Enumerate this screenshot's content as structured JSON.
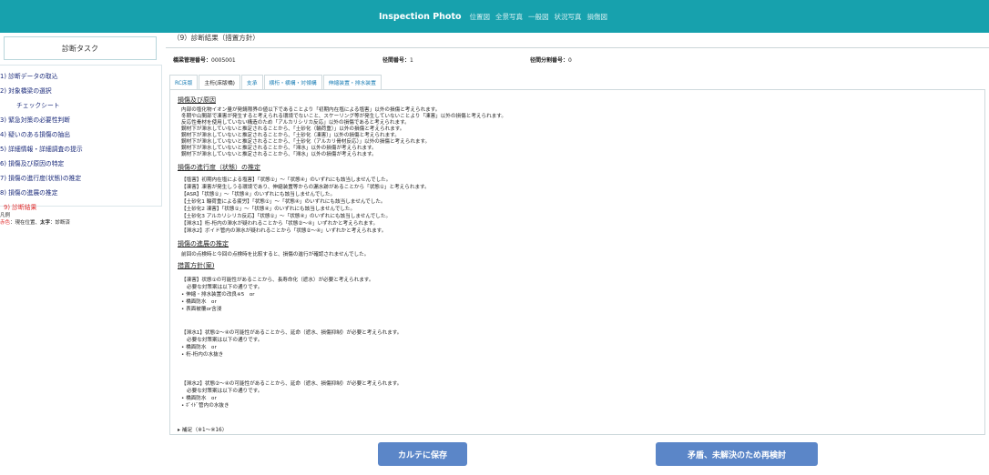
{
  "nav": {
    "brand": "Inspection Photo",
    "links": [
      "位置図",
      "全景写真",
      "一般図",
      "状況写真",
      "損傷図"
    ]
  },
  "sidebar": {
    "header": "診断タスク",
    "items": [
      "1) 診断データの取込",
      "2) 対象橋梁の選択",
      "チェックシート",
      "3) 緊急対策の必要性判断",
      "4) 疑いのある損傷の抽出",
      "5) 詳細情報・詳細調査の提示",
      "6) 損傷及び原因の特定",
      "7) 損傷の進行度(状態)の推定",
      "8) 損傷の進展の推定",
      "9) 診断結果"
    ],
    "legend_title": "凡例",
    "legend_red": "赤色",
    "legend_text": "：現在位置、",
    "legend_bold": "太字",
    "legend_text2": "：診断済"
  },
  "main": {
    "section_title": "（9）診断結果（措置方針）",
    "meta": {
      "bridge_label": "橋梁管理番号：",
      "bridge_value": "0005001",
      "span_label": "径間番号：",
      "span_value": "1",
      "span_div_label": "径間分割番号：",
      "span_div_value": "0"
    },
    "tabs": [
      "RC床版",
      "主桁(床版橋)",
      "支承",
      "横桁・横構・対傾構",
      "伸縮装置・排水装置"
    ],
    "damage_heading": "損傷及び原因",
    "damage_lines": [
      "内部の塩化物イオン量が発錆限界の値以下であることより「初期内在塩による塩害」以外の損傷と考えられます。",
      "冬期や山間部で凍害が発生すると考えられる環境でないこと、スケーリング等が発生していないことより「凍害」以外の損傷と考えられます。",
      "反応性骨材を使用していない構造のため「アルカリシリカ反応」以外の損傷であると考えられます。",
      "鋼材下が滞水していないと推定されることから、「土砂化（輪荷重）」以外の損傷と考えられます。",
      "鋼材下が滞水していないと推定されることから、「土砂化（凍害）」以外の損傷と考えられます。",
      "鋼材下が滞水していないと推定されることから、「土砂化（アルカリ骨材反応）」以外の損傷と考えられます。",
      "鋼材下が滞水していないと推定されることから、「滞水」以外の損傷が考えられます。",
      "鋼材下が滞水していないと推定されることから、「滞水」以外の損傷が考えられます。"
    ],
    "progress_heading": "損傷の進行度（状態）の推定",
    "progress_lines": [
      "【塩害】初期内在塩による塩害】「状態①」～「状態④」のいずれにも該当しませんでした。",
      "【凍害】凍害が発生しうる環境であり、伸縮装置等からの漏水跡があることから「状態①」と考えられます。",
      "【ASR】「状態①」～「状態④」のいずれにも該当しませんでした。",
      "【土砂化1 輪荷重による疲労】「状態①」～「状態④」のいずれにも該当しませんでした。",
      "【土砂化2 凍害】「状態①」～「状態④」のいずれにも該当しませんでした。",
      "【土砂化3 アルカリシリカ反応】「状態①」～「状態④」のいずれにも該当しませんでした。",
      "【滞水1】桁-桁内の滞水が疑われることから「状態②～④」いずれかと考えられます。",
      "【滞水2】ボイド管内の滞水が疑われることから「状態②～④」いずれかと考えられます。"
    ],
    "progress2_heading": "損傷の進展の推定",
    "progress2_lines": [
      "前回の点検時と今回の点検時を比較すると、損傷の進行が確認されませんでした。"
    ],
    "policy_heading": "措置方針(案)",
    "policy_block1": [
      "【凍害】状態①の可能性があることから、長寿命化（遮水）が必要と考えられます。",
      "必要な対策案は以下の通りです。",
      "•  伸縮・排水装置の改良※5　or",
      "•  橋面防水　or",
      "•  表面被覆or含浸"
    ],
    "policy_block2": [
      "【滞水1】状態②～④の可能性があることから、延命（遮水、損傷抑制）が必要と考えられます。",
      "必要な対策案は以下の通りです。",
      "•  橋面防水　or",
      "•  桁-桁内の水抜き"
    ],
    "policy_block3": [
      "【滞水2】状態②～④の可能性があることから、延命（遮水、損傷抑制）が必要と考えられます。",
      "必要な対策案は以下の通りです。",
      "•  橋面防水　or",
      "•  ﾎﾞｲﾄﾞ管内の水抜き"
    ],
    "details_summary": "▸ 補足（※1～※16）"
  },
  "buttons": {
    "save": "カルテに保存",
    "recheck": "矛盾、未解決のため再検討"
  },
  "colors": {
    "topbar": "#17a1ad",
    "button": "#5b86c8",
    "current": "#e13030"
  }
}
